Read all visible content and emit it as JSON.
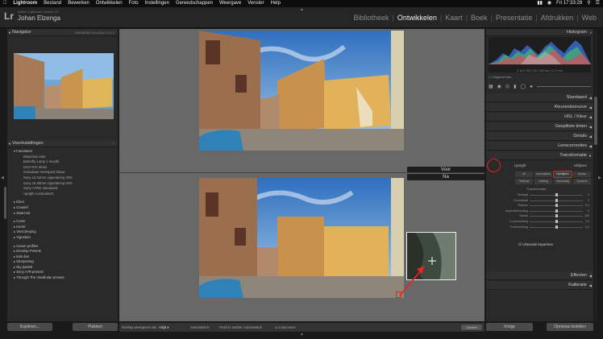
{
  "menubar": {
    "app": "Lightroom",
    "items": [
      "Bestand",
      "Bewerken",
      "Ontwikkelen",
      "Foto",
      "Instellingen",
      "Gereedschappen",
      "Weergave",
      "Venster",
      "Help"
    ],
    "clock": "Fri 17:33:28"
  },
  "identity": {
    "subtitle": "Adobe Lightroom Classic CC",
    "name": "Johan Elzenga",
    "logo": "Lr"
  },
  "modules": [
    "Bibliotheek",
    "Ontwikkelen",
    "Kaart",
    "Boek",
    "Presentatie",
    "Afdrukken",
    "Web"
  ],
  "active_module": "Ontwikkelen",
  "left_panel": {
    "navigator_title": "Navigator",
    "navigator_opts": "PASSEND  VULLEN  1:1  4:1",
    "presets_title": "Voorinstellingen",
    "presets": [
      {
        "level": 1,
        "text": "▾ Favorieten"
      },
      {
        "level": 2,
        "text": "Bleached color"
      },
      {
        "level": 2,
        "text": "Butterfly Lamp 1 results"
      },
      {
        "level": 2,
        "text": "DXO-IOV detail"
      },
      {
        "level": 2,
        "text": "Schaduwe metropool blauw"
      },
      {
        "level": 2,
        "text": "Sony 12-24mm vignettering 30%"
      },
      {
        "level": 2,
        "text": "Sony 16-35mm vignettering 50%"
      },
      {
        "level": 2,
        "text": "Sony-A7RIII standaard"
      },
      {
        "level": 2,
        "text": "Upright Automatisch"
      },
      {
        "level": 0,
        "text": ""
      },
      {
        "level": 1,
        "text": "▸ Kleur"
      },
      {
        "level": 1,
        "text": "▸ Creatief"
      },
      {
        "level": 1,
        "text": "▸ Zwart-wit"
      },
      {
        "level": 0,
        "text": ""
      },
      {
        "level": 1,
        "text": "▸ Curve"
      },
      {
        "level": 1,
        "text": "▸ Korrel"
      },
      {
        "level": 1,
        "text": "▸ Verscherping"
      },
      {
        "level": 1,
        "text": "▸ Vignetten"
      },
      {
        "level": 0,
        "text": ""
      },
      {
        "level": 1,
        "text": "▸ Canon profiles"
      },
      {
        "level": 1,
        "text": "▸ Develop Presets"
      },
      {
        "level": 1,
        "text": "▸ kats dan"
      },
      {
        "level": 1,
        "text": "▸ Sharpening"
      },
      {
        "level": 1,
        "text": "▸ sky pasteit"
      },
      {
        "level": 1,
        "text": "▸ Sony A7R presets"
      },
      {
        "level": 1,
        "text": "▸ Through The Viewfinder presets"
      }
    ],
    "copy_button": "Kopiëren...",
    "paste_button": "Plakken"
  },
  "center": {
    "before_label": "Voor",
    "after_label": "Na"
  },
  "toolbar": {
    "before_after_label": "Overlay weergeven als:",
    "before_after_value": "Altijd ♦",
    "zoom_label": "Automatisch:",
    "softproof_label": "Proef in zachte: Automatisch",
    "loupe_label": "Loep tonen",
    "done_button": "Gereed"
  },
  "right_panel": {
    "histogram_title": "Histogram",
    "histogram_readout": "f/ 16,0  ISO 100  1/60 sec  17,0 mm",
    "original_photo": "Origineel foto",
    "sections": [
      "Standaard",
      "Kleurentoonurve",
      "HSL / Kleur",
      "Gesplitste tinten",
      "Details",
      "Lenscorrecties",
      "Transformatie"
    ],
    "transform_tabs": [
      "Upright",
      "Uitlijnen"
    ],
    "upright_buttons": [
      "Uit",
      "Automatisch",
      "Niveau",
      "Verticaal",
      "Volledig",
      "Handmatig",
      "Richtlijnen",
      "Opnieuw"
    ],
    "highlighted_button": "Richtlijnen",
    "transform_group_title": "Transformatie",
    "sliders": [
      {
        "label": "Verticaal",
        "value": "0",
        "pos": 0.5
      },
      {
        "label": "Horizontaal",
        "value": "0",
        "pos": 0.5
      },
      {
        "label": "Roteren",
        "value": "0,0",
        "pos": 0.5
      },
      {
        "label": "Aspectverhouding",
        "value": "0",
        "pos": 0.5
      },
      {
        "label": "Schaal",
        "value": "100",
        "pos": 0.5
      },
      {
        "label": "X-verschuiving",
        "value": "0,0",
        "pos": 0.5
      },
      {
        "label": "Y-verschuiving",
        "value": "0,0",
        "pos": 0.5
      }
    ],
    "constrain_crop": "Uitsnede beperken",
    "bottom_sections": [
      "Effecten",
      "Kalibratie"
    ],
    "prev_button": "Vorige",
    "reset_button": "Opnieuw instellen"
  },
  "colors": {
    "panel": "#2a2a2a",
    "center_bg": "#686868",
    "highlight_red": "#dd2222",
    "active_module": "#f0f0f0"
  }
}
